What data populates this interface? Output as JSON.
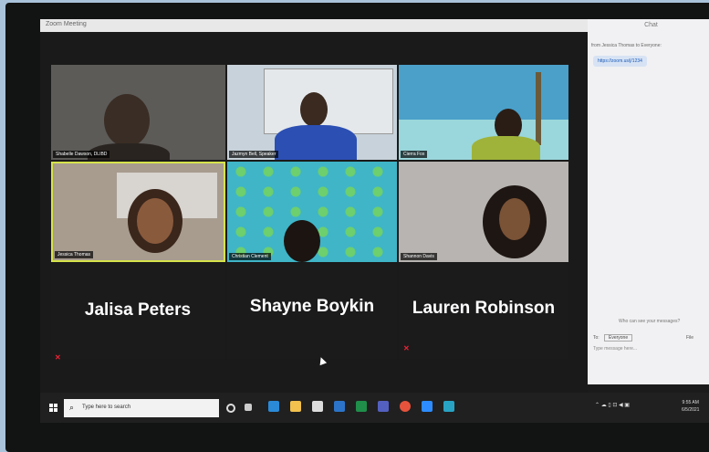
{
  "window": {
    "title": "Zoom Meeting"
  },
  "participants": [
    {
      "name": "Shabelle Dawson, DLIBD",
      "bg": "#5c5b58"
    },
    {
      "name": "Jazmyn Bell, Speaker",
      "bg": "#b9c6cf"
    },
    {
      "name": "Cierra Fox",
      "bg": "#4aa0c9"
    },
    {
      "name": "Jessica Thomas",
      "bg": "#a89c8f"
    },
    {
      "name": "Christian Clement",
      "bg": "#3fb5c7"
    },
    {
      "name": "Shannon Davis",
      "bg": "#b7b4b1"
    }
  ],
  "name_only_tiles": [
    {
      "name": "Jalisa Peters"
    },
    {
      "name": "Shayne Boykin"
    },
    {
      "name": "Lauren Robinson"
    }
  ],
  "chat": {
    "header": "Chat",
    "from_line": "from Jessica Thomas to Everyone:",
    "message": "https://zoom.us/j/1234",
    "who_can_see": "Who can see your messages?",
    "to_label": "To:",
    "to_value": "Everyone",
    "file_label": "File",
    "input_placeholder": "Type message here..."
  },
  "taskbar": {
    "search_placeholder": "Type here to search",
    "clock_time": "9:55 AM",
    "clock_date": "6/5/2021",
    "icons": [
      "task-view-icon",
      "edge-icon",
      "file-explorer-icon",
      "store-icon",
      "mail-icon",
      "excel-icon",
      "teams-icon",
      "chrome-icon",
      "zoom-icon",
      "generic-app-icon"
    ]
  }
}
